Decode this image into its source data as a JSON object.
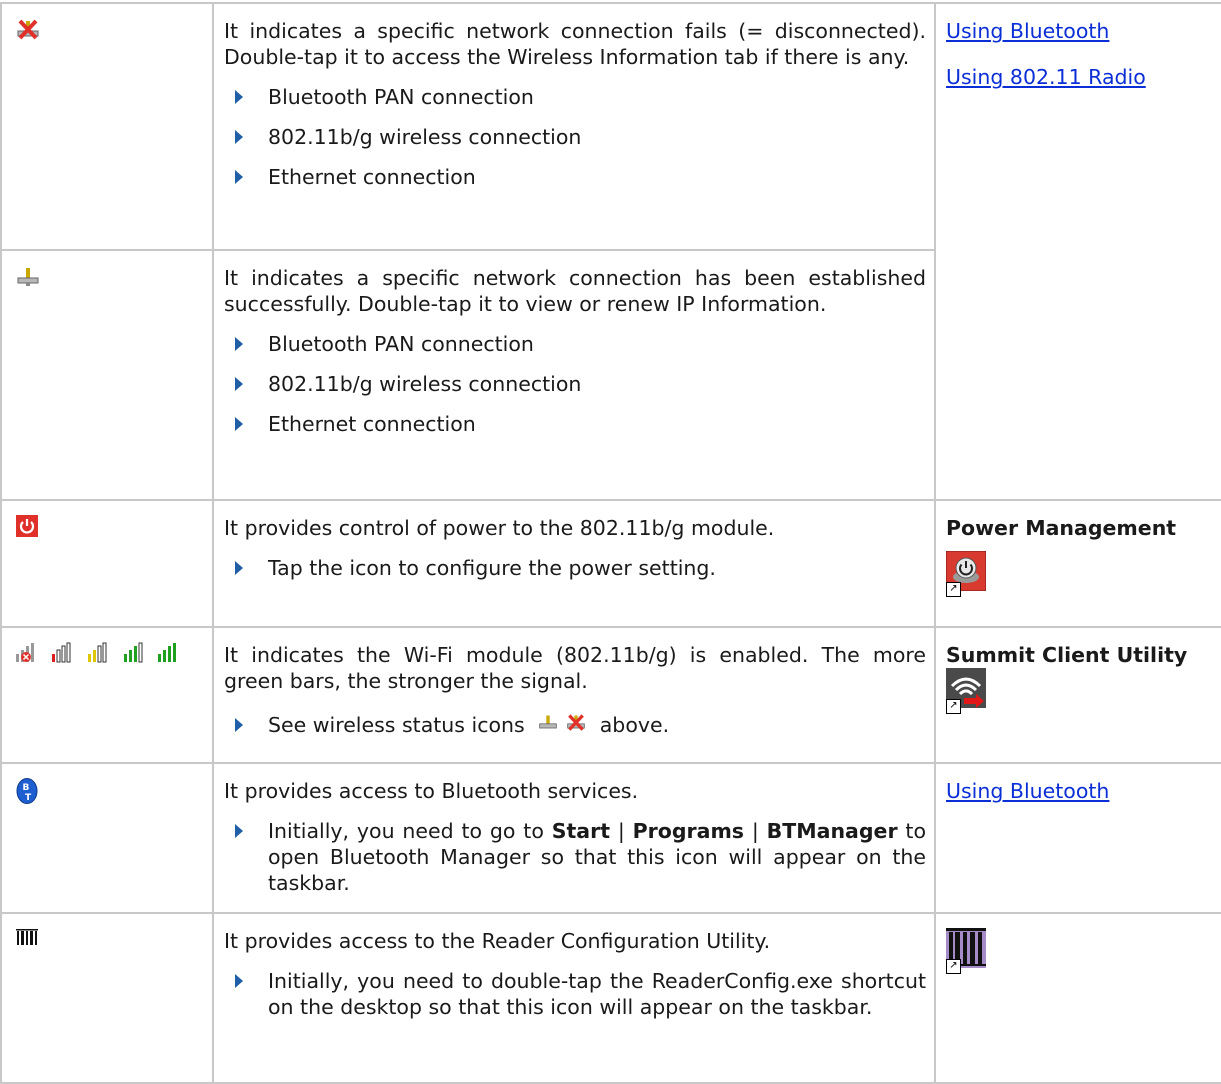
{
  "rows": [
    {
      "icon": "network-disconnected-icon",
      "description": "It indicates a specific network connection fails (= disconnected). Double-tap it to access the Wireless Information tab if there is any.",
      "bullets": [
        "Bluetooth PAN connection",
        "802.11b/g wireless connection",
        "Ethernet connection"
      ],
      "links": [
        "Using Bluetooth",
        "Using 802.11 Radio"
      ]
    },
    {
      "icon": "network-connected-icon",
      "description": "It indicates a specific network connection has been established successfully. Double-tap it to view or renew IP Information.",
      "bullets": [
        "Bluetooth PAN connection",
        "802.11b/g wireless connection",
        "Ethernet connection"
      ]
    },
    {
      "icon": "power-icon",
      "description": "It provides control of power to the 802.11b/g module.",
      "bullets": [
        "Tap the icon to configure the power setting."
      ],
      "ref_title": "Power Management",
      "ref_icon": "power-management-shortcut-icon"
    },
    {
      "icon": "wifi-signal-icons",
      "description": "It indicates the Wi-Fi module (802.11b/g) is enabled. The more green bars, the stronger the signal.",
      "bullet_prefix": "See wireless status icons",
      "bullet_suffix": "above.",
      "ref_title": "Summit Client Utility",
      "ref_icon": "summit-client-utility-shortcut-icon"
    },
    {
      "icon": "bluetooth-icon",
      "description": "It provides access to Bluetooth services.",
      "bullet_parts": [
        "Initially, you need to go to ",
        "Start",
        " | ",
        "Programs",
        " | ",
        "BTManager",
        " to open Bluetooth Manager so that this icon will appear on the taskbar."
      ],
      "links": [
        "Using Bluetooth"
      ]
    },
    {
      "icon": "barcode-reader-icon",
      "description": "It provides access to the Reader Configuration Utility.",
      "bullets": [
        "Initially, you need to double-tap the ReaderConfig.exe shortcut on the desktop so that this icon will appear on the taskbar."
      ],
      "ref_icon": "reader-config-shortcut-icon"
    }
  ],
  "colors": {
    "link": "#0b2fd6",
    "bullet_arrow": "#1f5fa8",
    "border": "#c8c8c8",
    "power_red": "#e0302a",
    "signal_green": "#1fa01f",
    "bluetooth_blue": "#1d5fd0"
  }
}
